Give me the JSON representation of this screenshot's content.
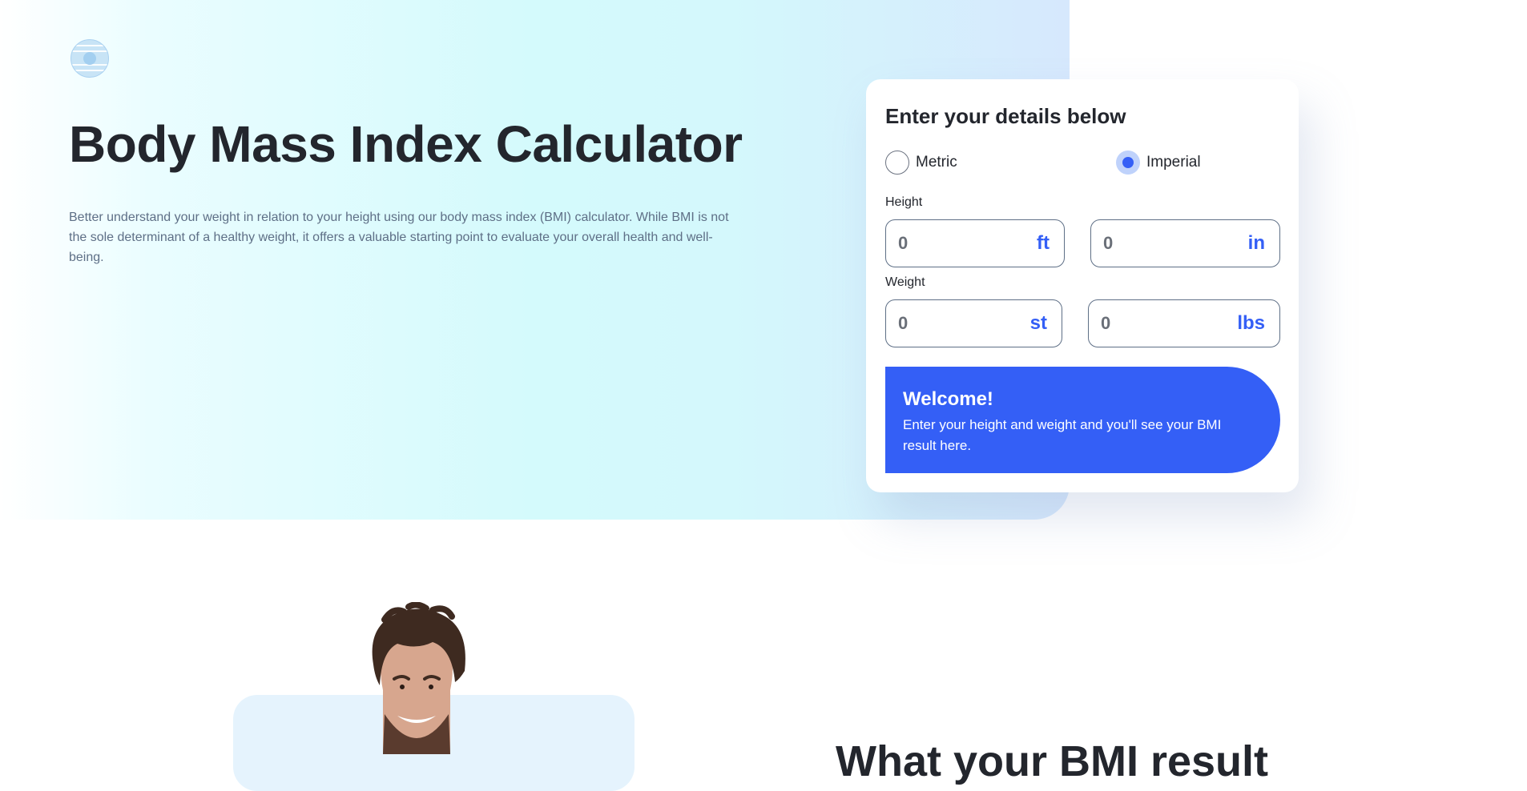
{
  "hero": {
    "title": "Body Mass Index Calculator",
    "description": "Better understand your weight in relation to your height using our body mass index (BMI) calculator. While BMI is not the sole determinant of a healthy weight, it offers a valuable starting point to evaluate your overall health and well-being."
  },
  "calculator": {
    "title": "Enter your details below",
    "units": {
      "metric_label": "Metric",
      "imperial_label": "Imperial",
      "selected": "Imperial"
    },
    "height": {
      "label": "Height",
      "feet": {
        "value": "0",
        "unit": "ft"
      },
      "inches": {
        "value": "0",
        "unit": "in"
      }
    },
    "weight": {
      "label": "Weight",
      "stone": {
        "value": "0",
        "unit": "st"
      },
      "pounds": {
        "value": "0",
        "unit": "lbs"
      }
    },
    "result": {
      "title": "Welcome!",
      "message": "Enter your height and weight and you'll see your BMI result here."
    }
  },
  "section": {
    "heading": "What your BMI result"
  },
  "colors": {
    "accent": "#345ff6",
    "text_dark": "#23262d",
    "text_muted": "#5e6f86",
    "hero_gradient": [
      "#d4fafc",
      "#d6e8fd"
    ],
    "panel_bg": "#e5f3fd"
  },
  "icons": {
    "logo": "striped-circle-logo"
  }
}
